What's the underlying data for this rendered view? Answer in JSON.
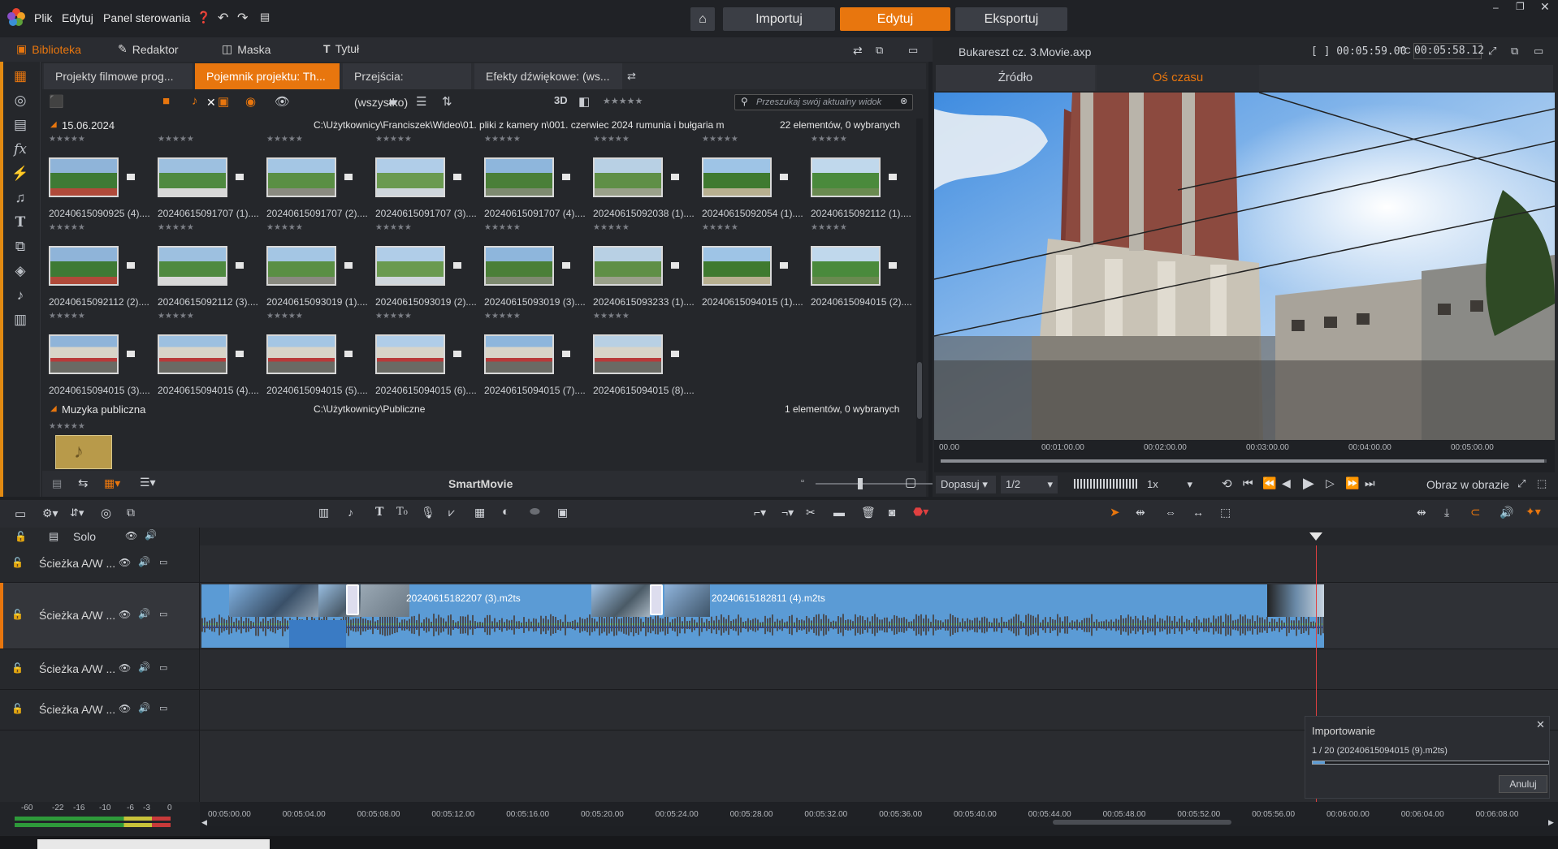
{
  "menu": {
    "file": "Plik",
    "edit": "Edytuj",
    "control_panel": "Panel sterowania"
  },
  "modes": {
    "import": "Importuj",
    "edit": "Edytuj",
    "export": "Eksportuj"
  },
  "library_tabs": {
    "library": "Biblioteka",
    "editor": "Redaktor",
    "mask": "Maska",
    "title": "Tytuł"
  },
  "bins": [
    "Projekty filmowe prog...",
    "Pojemnik projektu: Th...",
    "Przejścia: (wszystko)",
    "Efekty dźwiękowe: (ws..."
  ],
  "toolbar": {
    "three_d": "3D",
    "search_placeholder": "Przeszukaj swój aktualny widok"
  },
  "group1": {
    "date": "15.06.2024",
    "path": "C:\\Użytkownicy\\Franciszek\\Wideo\\01. pliki z kamery n\\001. czerwiec 2024 rumunia i bułgaria m",
    "count": "22 elementów, 0 wybranych"
  },
  "clips": [
    "20240615090925 (4)....",
    "20240615091707 (1)....",
    "20240615091707 (2)....",
    "20240615091707 (3)....",
    "20240615091707 (4)....",
    "20240615092038 (1)....",
    "20240615092054 (1)....",
    "20240615092112 (1)....",
    "20240615092112 (2)....",
    "20240615092112 (3)....",
    "20240615093019 (1)....",
    "20240615093019 (2)....",
    "20240615093019 (3)....",
    "20240615093233 (1)....",
    "20240615094015 (1)....",
    "20240615094015 (2)....",
    "20240615094015 (3)....",
    "20240615094015 (4)....",
    "20240615094015 (5)....",
    "20240615094015 (6)....",
    "20240615094015 (7)....",
    "20240615094015 (8)...."
  ],
  "group2": {
    "name": "Muzyka publiczna",
    "path": "C:\\Użytkownicy\\Publiczne",
    "count": "1 elementów, 0 wybranych"
  },
  "smartmovie": "SmartMovie",
  "preview": {
    "project": "Bukareszt cz. 3.Movie.axp",
    "duration": "[ ] 00:05:59.00",
    "tc_label": "TC",
    "timecode": "00:05:58.12",
    "tab_source": "Źródło",
    "tab_timeline": "Oś czasu",
    "ruler": [
      "00.00",
      "00:01:00.00",
      "00:02:00.00",
      "00:03:00.00",
      "00:04:00.00",
      "00:05:00.00"
    ],
    "fit": "Dopasuj",
    "ratio": "1/2",
    "speed": "1x",
    "pip": "Obraz w obrazie"
  },
  "timeline": {
    "solo": "Solo",
    "tracks": [
      "Ścieżka A/W ...",
      "Ścieżka A/W ...",
      "Ścieżka A/W ...",
      "Ścieżka A/W ..."
    ],
    "clip1": "20240615182207 (3).m2ts",
    "clip2": "20240615182811 (4).m2ts",
    "ruler": [
      "00:05:00.00",
      "00:05:04.00",
      "00:05:08.00",
      "00:05:12.00",
      "00:05:16.00",
      "00:05:20.00",
      "00:05:24.00",
      "00:05:28.00",
      "00:05:32.00",
      "00:05:36.00",
      "00:05:40.00",
      "00:05:44.00",
      "00:05:48.00",
      "00:05:52.00",
      "00:05:56.00",
      "00:06:00.00",
      "00:06:04.00",
      "00:06:08.00"
    ],
    "vu_scale": [
      "-60",
      "-22",
      "-16",
      "-10",
      "-6",
      "-3",
      "0"
    ]
  },
  "importing": {
    "title": "Importowanie",
    "progress_text": "1 / 20 (20240615094015 (9).m2ts)",
    "cancel": "Anuluj",
    "progress": 0.05
  },
  "colors": {
    "accent": "#e8760e",
    "clip": "#5b9bd5",
    "playhead": "#e04040"
  }
}
